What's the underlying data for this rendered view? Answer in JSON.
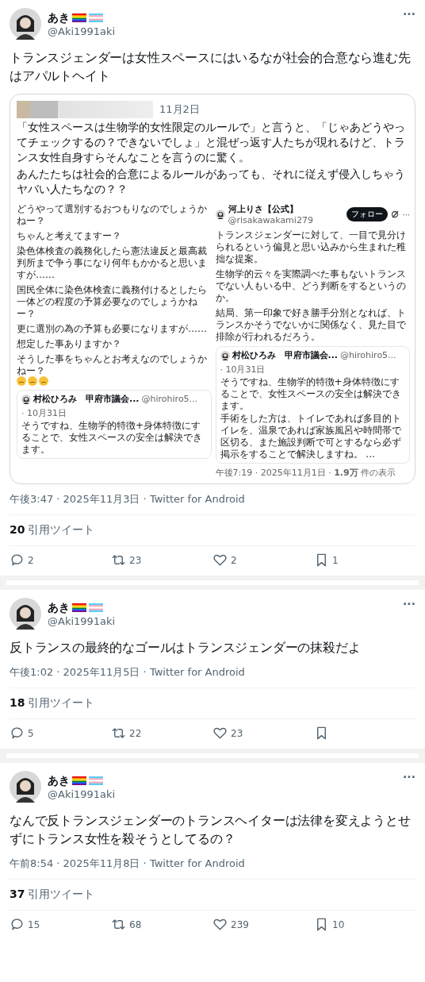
{
  "tweets": [
    {
      "author": {
        "name": "あき",
        "handle": "@Aki1991aki"
      },
      "more": "···",
      "text": [
        "トランスジェンダーは女性スペースにはいるなが社会的合意なら進む先はアパルトヘイト"
      ],
      "quote": {
        "date": "11月2日",
        "paragraphs": [
          "「女性スペースは生物学的女性限定のルールで」と言うと、「じゃあどうやってチェックするの？できないでしょ」と混ぜっ返す人たちが現れるけど、トランス女性自身すらそんなことを言うのに驚く。",
          "あんたたちは社会的合意によるルールがあっても、それに従えず侵入しちゃうヤバい人たちなの？？"
        ],
        "image": {
          "left": {
            "paragraphs": [
              "どうやって選別するおつもりなのでしょうかねー？",
              "ちゃんと考えてますー？",
              "染色体検査の義務化したら憲法違反と最高裁判所まで争う事になり何年もかかると思いますが……",
              "国民全体に染色体検査に義務付けるとしたら一体どの程度の予算必要なのでしょうかねー？",
              "更に選別の為の予算も必要になりますが……",
              "想定した事ありますか？",
              "そうした事をちゃんとお考えなのでしょうかねー？"
            ],
            "nested": {
              "name": "村松ひろみ　甲府市議会...",
              "handle": "@hirohiro5...",
              "date": "· 10月31日",
              "lines": [
                "そうですね、生物学的特徴+身体特徴にすることで、女性スペースの安全は解決できます。"
              ]
            }
          },
          "right": {
            "name": "河上りさ【公式】",
            "handle": "@risakawakami279",
            "follow": "フォロー",
            "more": "···",
            "paragraphs": [
              "トランスジェンダーに対して、一目で見分けられるという偏見と思い込みから生まれた稚拙な提案。",
              "生物学的云々を実際調べた事もないトランスでない人もいる中、どう判断をするというのか。",
              "結局、第一印象で好き勝手分別となれば、トランスかそうでないかに関係なく、見た目で排除が行われるだろう。"
            ],
            "nested": {
              "name": "村松ひろみ　甲府市議会...",
              "handle": "@hirohiro5...",
              "date": "· 10月31日",
              "lines": [
                "そうですね、生物学的特徴+身体特徴にすることで、女性スペースの安全は解決できます。",
                "手術をした方は、トイレであれば多目的トイレを、温泉であれば家族風呂や時間帯で区切る、また施設判断で可とするなら必ず掲示をすることで解決しますね。 ..."
              ]
            },
            "footer": "午後7:19 · 2025年11月1日 · **1.9万** 件の表示"
          }
        }
      },
      "meta": "午後3:47 · 2025年11月3日 · Twitter for Android",
      "quote_count": "20",
      "quote_label": "引用ツイート",
      "actions": {
        "replies": "2",
        "retweets": "23",
        "likes": "2",
        "bookmarks": "1"
      }
    },
    {
      "author": {
        "name": "あき",
        "handle": "@Aki1991aki"
      },
      "more": "···",
      "text": [
        "反トランスの最終的なゴールはトランスジェンダーの抹殺だよ"
      ],
      "meta": "午後1:02 · 2025年11月5日 · Twitter for Android",
      "quote_count": "18",
      "quote_label": "引用ツイート",
      "actions": {
        "replies": "5",
        "retweets": "22",
        "likes": "23"
      }
    },
    {
      "author": {
        "name": "あき",
        "handle": "@Aki1991aki"
      },
      "more": "···",
      "text": [
        "なんで反トランスジェンダーのトランスヘイターは法律を変えようとせずにトランス女性を殺そうとしてるの？"
      ],
      "meta": "午前8:54 · 2025年11月8日 · Twitter for Android",
      "quote_count": "37",
      "quote_label": "引用ツイート",
      "actions": {
        "replies": "15",
        "retweets": "68",
        "likes": "239",
        "bookmarks": "10"
      }
    }
  ]
}
